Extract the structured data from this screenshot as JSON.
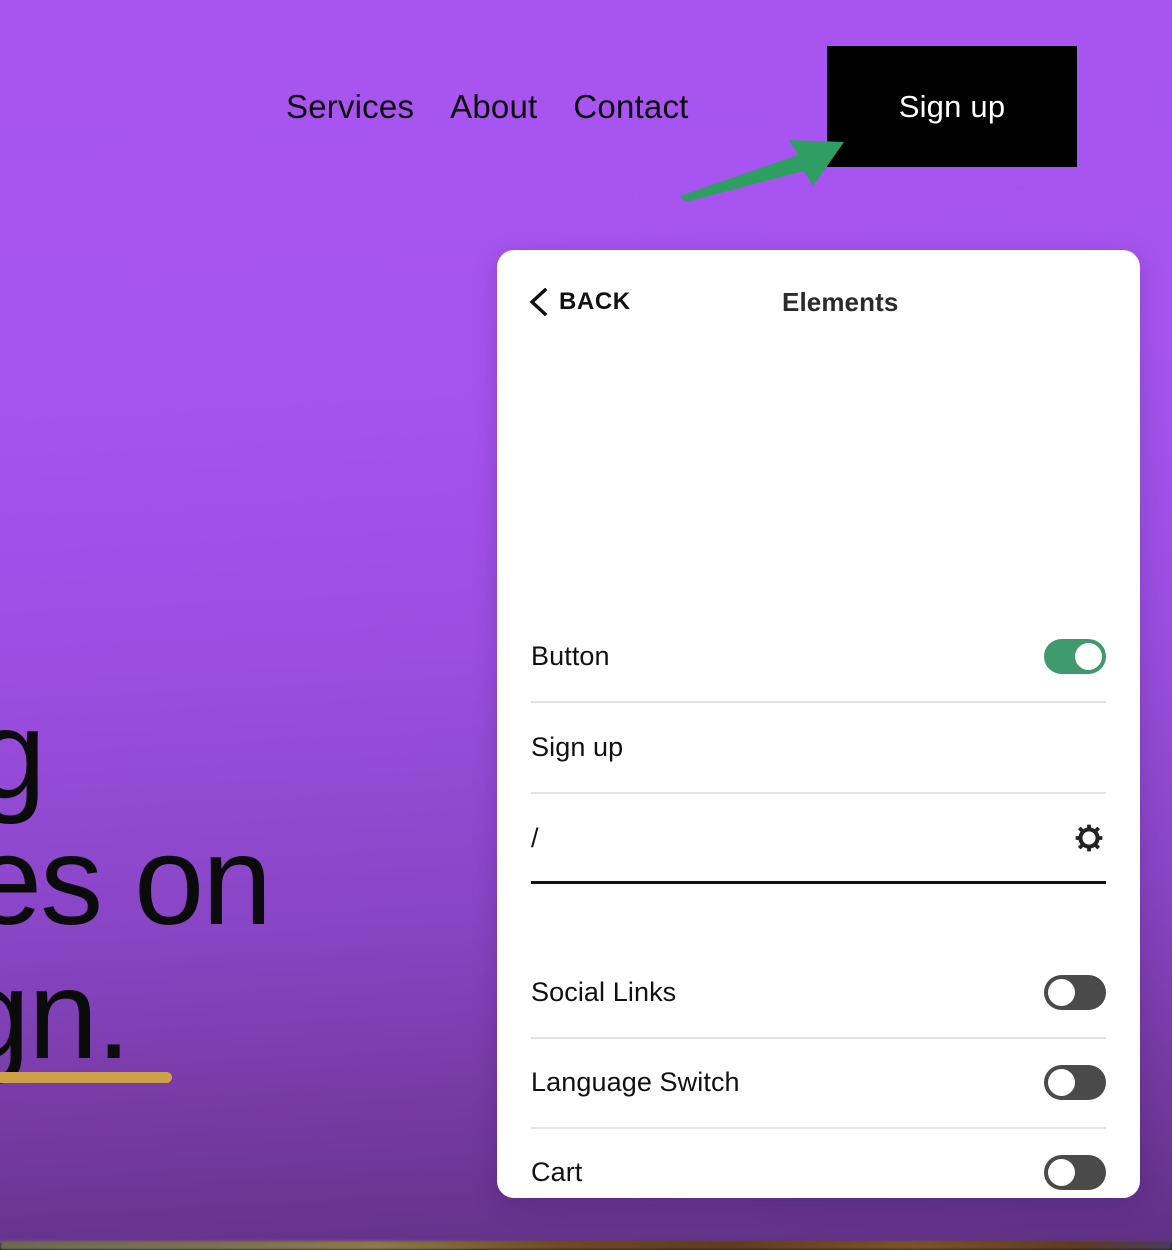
{
  "colors": {
    "page_bg_top": "#a855f0",
    "page_bg_bottom": "#5f3184",
    "annotation_arrow": "#2f9e63",
    "toggle_on": "#3f9a6c",
    "toggle_off": "#4a4a4a",
    "signup_button_bg": "#000000",
    "signup_button_text": "#ffffff",
    "panel_bg": "#ffffff",
    "divider": "#e3e3e3",
    "divider_active": "#111111",
    "hero_underline": "#cca14a",
    "hero_text": "#0b0b0b"
  },
  "site": {
    "nav": [
      {
        "label": "Services",
        "icon": "nav-link-icon"
      },
      {
        "label": "About",
        "icon": "nav-link-icon"
      },
      {
        "label": "Contact",
        "icon": "nav-link-icon"
      }
    ],
    "signup_button_label": "Sign up",
    "hero": {
      "line1": "g",
      "line2": "es on",
      "line3": "gn."
    }
  },
  "annotations": [
    {
      "name": "arrow-to-signup-button",
      "direction": "up-right",
      "color": "#2f9e63"
    },
    {
      "name": "arrow-to-button-toggle",
      "direction": "right",
      "color": "#2f9e63"
    },
    {
      "name": "arrow-to-button-label-field",
      "direction": "left",
      "color": "#2f9e63"
    },
    {
      "name": "arrow-to-button-link-field",
      "direction": "left",
      "color": "#2f9e63"
    }
  ],
  "panel": {
    "back_label": "BACK",
    "back_icon": "chevron-left-icon",
    "title": "Elements",
    "group_one": [
      {
        "id": "button",
        "label": "Button",
        "control": "toggle",
        "state": "on"
      },
      {
        "id": "button-text",
        "label": "Sign up",
        "control": "text-field",
        "value": "Sign up"
      },
      {
        "id": "button-link",
        "label": "/",
        "control": "text-field",
        "value": "/",
        "trailing_icon": "gear-icon",
        "focused": true
      }
    ],
    "group_two": [
      {
        "id": "social-links",
        "label": "Social Links",
        "control": "toggle",
        "state": "off"
      },
      {
        "id": "language-switch",
        "label": "Language Switch",
        "control": "toggle",
        "state": "off"
      },
      {
        "id": "cart",
        "label": "Cart",
        "control": "toggle",
        "state": "off"
      }
    ]
  }
}
